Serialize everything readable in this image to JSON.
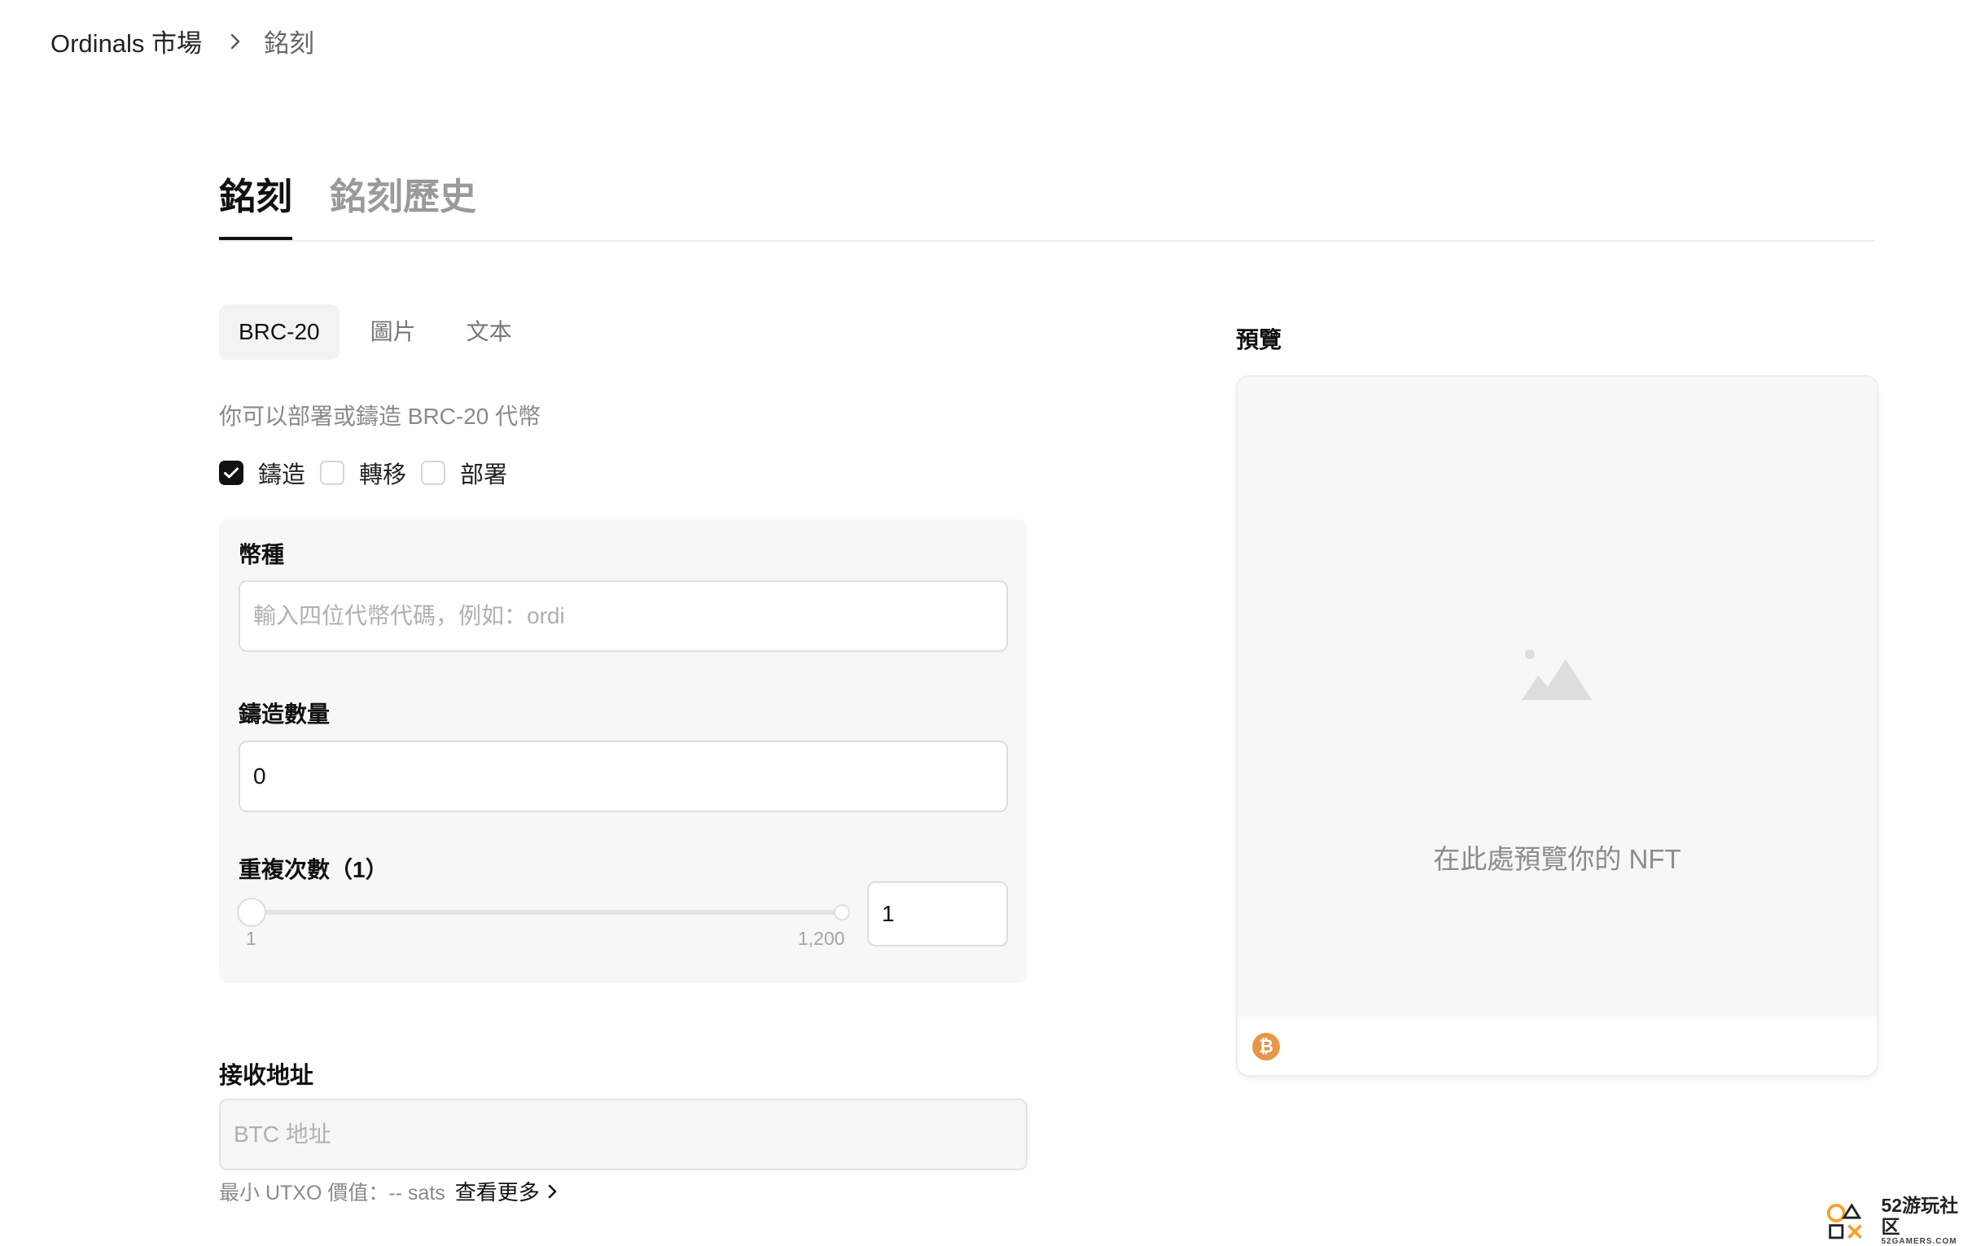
{
  "breadcrumb": {
    "root": "Ordinals 市場",
    "current": "銘刻",
    "separator_icon": "chevron-right-icon"
  },
  "main_tabs": [
    {
      "label": "銘刻",
      "active": true
    },
    {
      "label": "銘刻歷史",
      "active": false
    }
  ],
  "type_tabs": [
    {
      "label": "BRC-20",
      "active": true
    },
    {
      "label": "圖片",
      "active": false
    },
    {
      "label": "文本",
      "active": false
    }
  ],
  "hint": "你可以部署或鑄造 BRC-20 代幣",
  "operations": [
    {
      "label": "鑄造",
      "checked": true
    },
    {
      "label": "轉移",
      "checked": false
    },
    {
      "label": "部署",
      "checked": false
    }
  ],
  "form": {
    "token_label": "幣種",
    "token_placeholder": "輸入四位代幣代碼，例如：ordi",
    "token_value": "",
    "mint_amount_label": "鑄造數量",
    "mint_amount_value": "0",
    "repeat_label": "重複次數（1）",
    "repeat_min": "1",
    "repeat_max": "1,200",
    "repeat_value": "1"
  },
  "receive": {
    "label": "接收地址",
    "placeholder": "BTC 地址",
    "utxo_text": "最小 UTXO 價值：-- sats",
    "more_link": "查看更多",
    "more_icon": "chevron-right-icon"
  },
  "preview": {
    "title": "預覽",
    "placeholder": "在此處預覽你的 NFT",
    "image_icon": "image-placeholder-icon",
    "chain_icon": "bitcoin-icon",
    "chain_glyph": "₿"
  },
  "watermark": {
    "title": "52游玩社区",
    "subtitle": "52GAMERS.COM"
  },
  "colors": {
    "accent": "#111111",
    "bitcoin": "#E8964A",
    "panel_bg": "#F7F7F7",
    "muted_text": "#8A8A8A"
  }
}
